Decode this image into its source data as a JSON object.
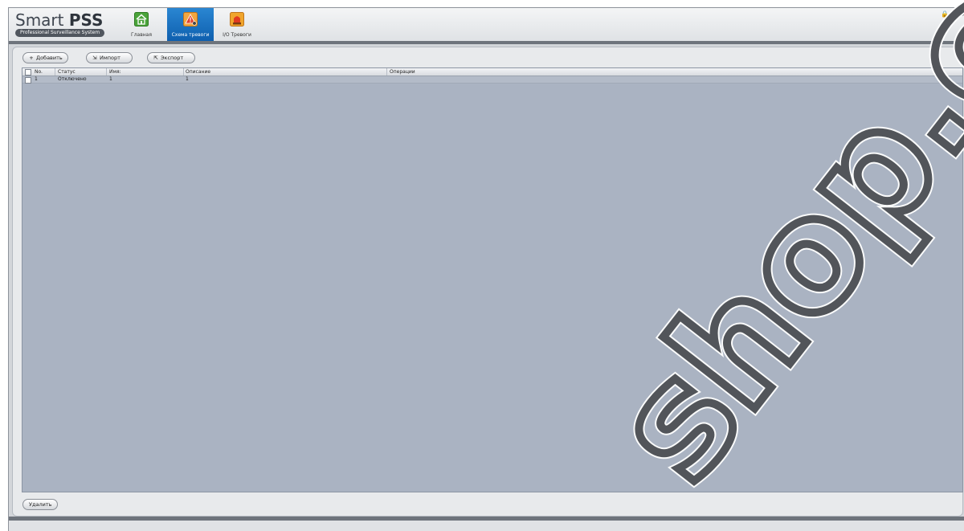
{
  "app": {
    "logo_main": "Smart",
    "logo_bold": "PSS",
    "logo_sub": "Professional Surveillance System"
  },
  "tabs": [
    {
      "label": "Главная",
      "icon": "home-icon",
      "active": false
    },
    {
      "label": "Схема тревоги",
      "icon": "alarm-scheme-icon",
      "active": true
    },
    {
      "label": "I/O Тревоги",
      "icon": "alarm-light-icon",
      "active": false
    }
  ],
  "window_controls": {
    "lock": "🔒",
    "minimize": "–",
    "maximize": "□",
    "close": "×"
  },
  "toolbar": {
    "add_label": "Добавить",
    "import_label": "Импорт",
    "export_label": "Экспорт"
  },
  "table": {
    "columns": [
      "No.",
      "Статус",
      "Имя:",
      "Описание",
      "Операции"
    ],
    "rows": [
      {
        "no": "1",
        "status": "Отключено",
        "name": "1",
        "description": "1",
        "operations": ""
      }
    ]
  },
  "footer": {
    "delete_label": "Удалить"
  },
  "watermark_text": "shop.com",
  "colors": {
    "active_tab": "#1a6fc0",
    "table_body": "#aab3c2",
    "frame_band": "#6e747c"
  }
}
